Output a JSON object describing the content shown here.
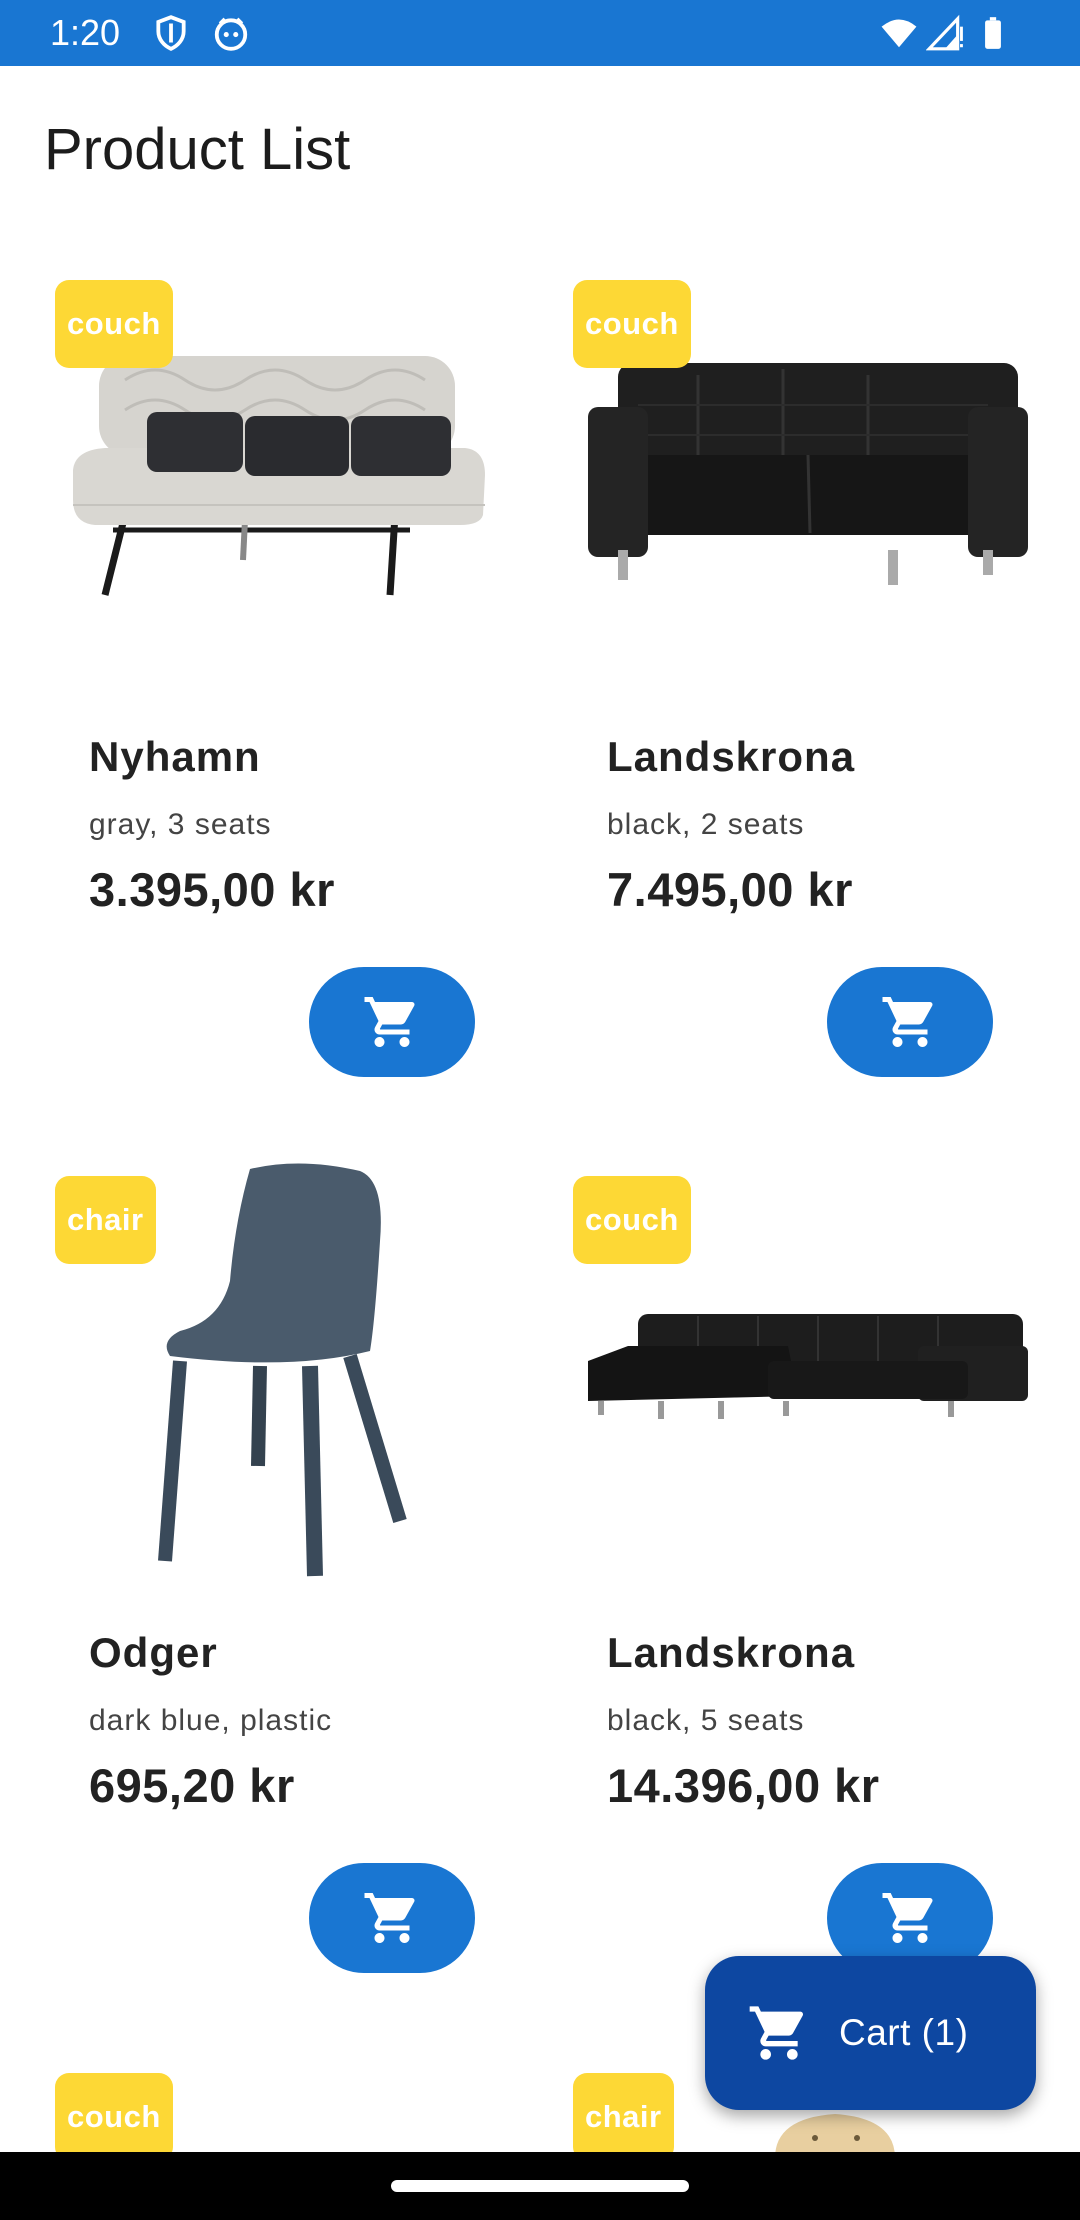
{
  "status": {
    "time": "1:20"
  },
  "page": {
    "title": "Product List"
  },
  "products": [
    {
      "category": "couch",
      "name": "Nyhamn",
      "desc": "gray, 3 seats",
      "price": "3.395,00 kr"
    },
    {
      "category": "couch",
      "name": "Landskrona",
      "desc": "black, 2 seats",
      "price": "7.495,00 kr"
    },
    {
      "category": "chair",
      "name": "Odger",
      "desc": "dark blue, plastic",
      "price": "695,20 kr"
    },
    {
      "category": "couch",
      "name": "Landskrona",
      "desc": "black, 5 seats",
      "price": "14.396,00 kr"
    },
    {
      "category": "couch"
    },
    {
      "category": "chair"
    }
  ],
  "fab": {
    "label": "Cart (1)"
  },
  "icons": {
    "status": [
      "shield-icon",
      "face-icon",
      "wifi-icon",
      "signal-icon",
      "battery-icon"
    ],
    "cart": "cart-icon"
  },
  "colors": {
    "primary": "#1976d2",
    "fab": "#0d47a1",
    "badge": "#fdd835"
  }
}
